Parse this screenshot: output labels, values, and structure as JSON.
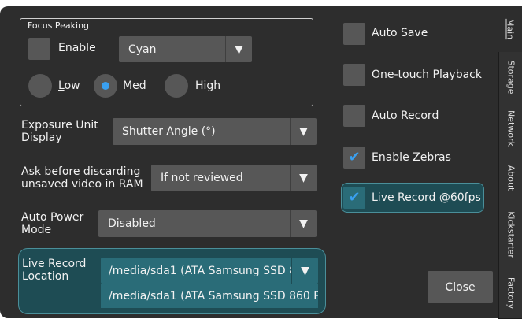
{
  "focus_peaking": {
    "title": "Focus Peaking",
    "enable_label": "Enable",
    "color_value": "Cyan",
    "levels": [
      "Low",
      "Med",
      "High"
    ],
    "selected_level": "Med"
  },
  "exposure_unit": {
    "label": "Exposure Unit Display",
    "value": "Shutter Angle (°)"
  },
  "ask_discard": {
    "label": "Ask before discarding unsaved video in RAM",
    "value": "If not reviewed"
  },
  "auto_power": {
    "label": "Auto Power Mode",
    "value": "Disabled"
  },
  "live_record_location": {
    "label": "Live Record Location",
    "value": "/media/sda1 (ATA Samsung SSD 86",
    "option": "/media/sda1 (ATA Samsung SSD 860 P..."
  },
  "toggles": [
    {
      "label": "Auto Save",
      "checked": false
    },
    {
      "label": "One-touch Playback",
      "checked": false
    },
    {
      "label": "Auto Record",
      "checked": false
    },
    {
      "label": "Enable Zebras",
      "checked": true
    },
    {
      "label": "Live Record @60fps",
      "checked": true
    }
  ],
  "close_label": "Close",
  "tabs": [
    "Main",
    "Storage",
    "Network",
    "About",
    "Kickstarter",
    "Factory"
  ],
  "colors": {
    "accent": "#3aa0f0",
    "teal_highlight": "#1e4c54",
    "background": "#2d2d2d",
    "control": "#575757"
  }
}
